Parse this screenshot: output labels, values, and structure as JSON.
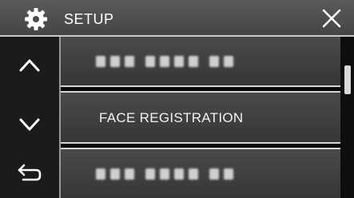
{
  "header": {
    "title": "SETUP",
    "settings_icon": "gear-icon",
    "close_icon": "close-icon"
  },
  "nav": {
    "up_icon": "chevron-up-icon",
    "down_icon": "chevron-down-icon",
    "back_icon": "return-arrow-icon"
  },
  "list": {
    "items": [
      {
        "label": "",
        "state": "blurred"
      },
      {
        "label": "FACE REGISTRATION",
        "state": "normal"
      },
      {
        "label": "",
        "state": "blurred"
      }
    ]
  },
  "scrollbar": {
    "position": 0.18
  },
  "colors": {
    "header_bg": "#4f4f4f",
    "row_bg": "#404040",
    "text": "#ffffff",
    "divider": "#d4d4d4"
  }
}
